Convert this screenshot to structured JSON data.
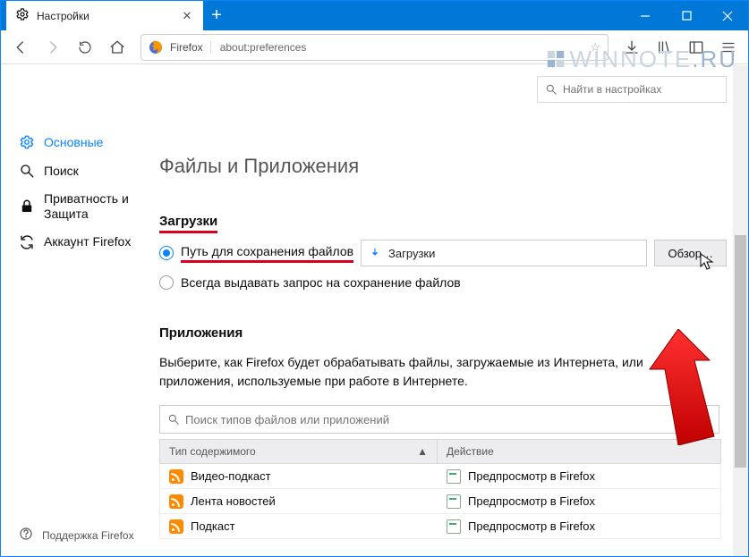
{
  "tab": {
    "title": "Настройки"
  },
  "address": {
    "prefix": "Firefox",
    "url": "about:preferences"
  },
  "sidebar": {
    "items": [
      {
        "label": "Основные"
      },
      {
        "label": "Поиск"
      },
      {
        "label": "Приватность и Защита"
      },
      {
        "label": "Аккаунт Firefox"
      }
    ],
    "support": "Поддержка Firefox"
  },
  "search_settings_placeholder": "Найти в настройках",
  "section_title": "Файлы и Приложения",
  "downloads": {
    "heading": "Загрузки",
    "save_to_label": "Путь для сохранения файлов",
    "folder_name": "Загрузки",
    "browse": "Обзор…",
    "always_ask": "Всегда выдавать запрос на сохранение файлов"
  },
  "apps": {
    "heading": "Приложения",
    "description": "Выберите, как Firefox будет обрабатывать файлы, загружаемые из Интернета, или приложения, используемые при работе в Интернете.",
    "filter_placeholder": "Поиск типов файлов или приложений",
    "col_type": "Тип содержимого",
    "col_action": "Действие",
    "rows": [
      {
        "type": "Видео-подкаст",
        "action": "Предпросмотр в Firefox"
      },
      {
        "type": "Лента новостей",
        "action": "Предпросмотр в Firefox"
      },
      {
        "type": "Подкаст",
        "action": "Предпросмотр в Firefox"
      }
    ]
  },
  "watermark": {
    "text1": "WINNOTE",
    "text2": ".RU"
  }
}
